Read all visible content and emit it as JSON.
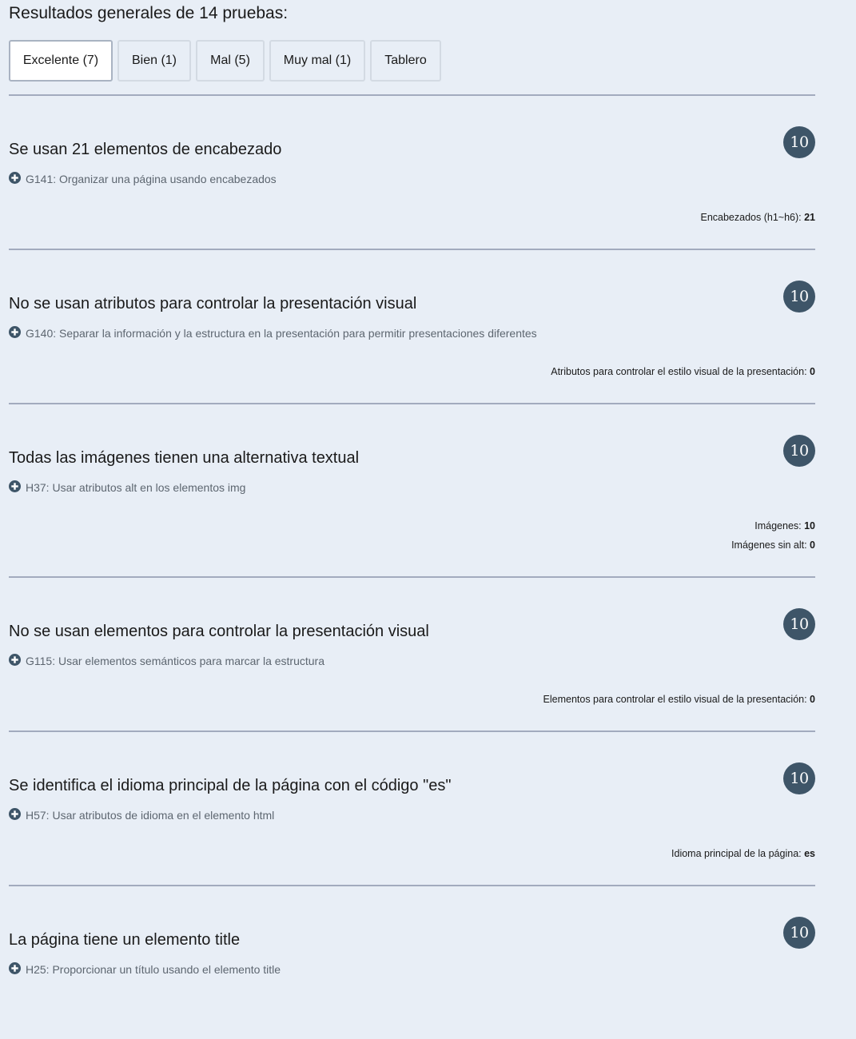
{
  "summary": {
    "title": "Resultados generales de 14 pruebas:"
  },
  "tabs": [
    {
      "label": "Excelente (7)",
      "active": true
    },
    {
      "label": "Bien (1)",
      "active": false
    },
    {
      "label": "Mal (5)",
      "active": false
    },
    {
      "label": "Muy mal (1)",
      "active": false
    },
    {
      "label": "Tablero",
      "active": false
    }
  ],
  "tests": [
    {
      "score": "10",
      "title": "Se usan 21 elementos de encabezado",
      "technique": "G141: Organizar una página usando encabezados",
      "metrics": [
        {
          "label": "Encabezados (h1~h6): ",
          "value": "21"
        }
      ]
    },
    {
      "score": "10",
      "title": "No se usan atributos para controlar la presentación visual",
      "technique": "G140: Separar la información y la estructura en la presentación para permitir presentaciones diferentes",
      "metrics": [
        {
          "label": "Atributos para controlar el estilo visual de la presentación: ",
          "value": "0"
        }
      ]
    },
    {
      "score": "10",
      "title": "Todas las imágenes tienen una alternativa textual",
      "technique": "H37: Usar atributos alt en los elementos img",
      "metrics": [
        {
          "label": "Imágenes: ",
          "value": "10"
        },
        {
          "label": "Imágenes sin alt: ",
          "value": "0"
        }
      ]
    },
    {
      "score": "10",
      "title": "No se usan elementos para controlar la presentación visual",
      "technique": "G115: Usar elementos semánticos para marcar la estructura",
      "metrics": [
        {
          "label": "Elementos para controlar el estilo visual de la presentación: ",
          "value": "0"
        }
      ]
    },
    {
      "score": "10",
      "title": "Se identifica el idioma principal de la página con el código \"es\"",
      "technique": "H57: Usar atributos de idioma en el elemento html",
      "metrics": [
        {
          "label": "Idioma principal de la página: ",
          "value": "es"
        }
      ]
    },
    {
      "score": "10",
      "title": "La página tiene un elemento title",
      "technique": "H25: Proporcionar un título usando el elemento title",
      "metrics": []
    }
  ],
  "colors": {
    "background": "#e8eef6",
    "badge": "#3e5568",
    "divider": "#a2abbe",
    "technique_text": "#5d6670"
  },
  "icons": {
    "expand": "plus-circle-icon"
  }
}
